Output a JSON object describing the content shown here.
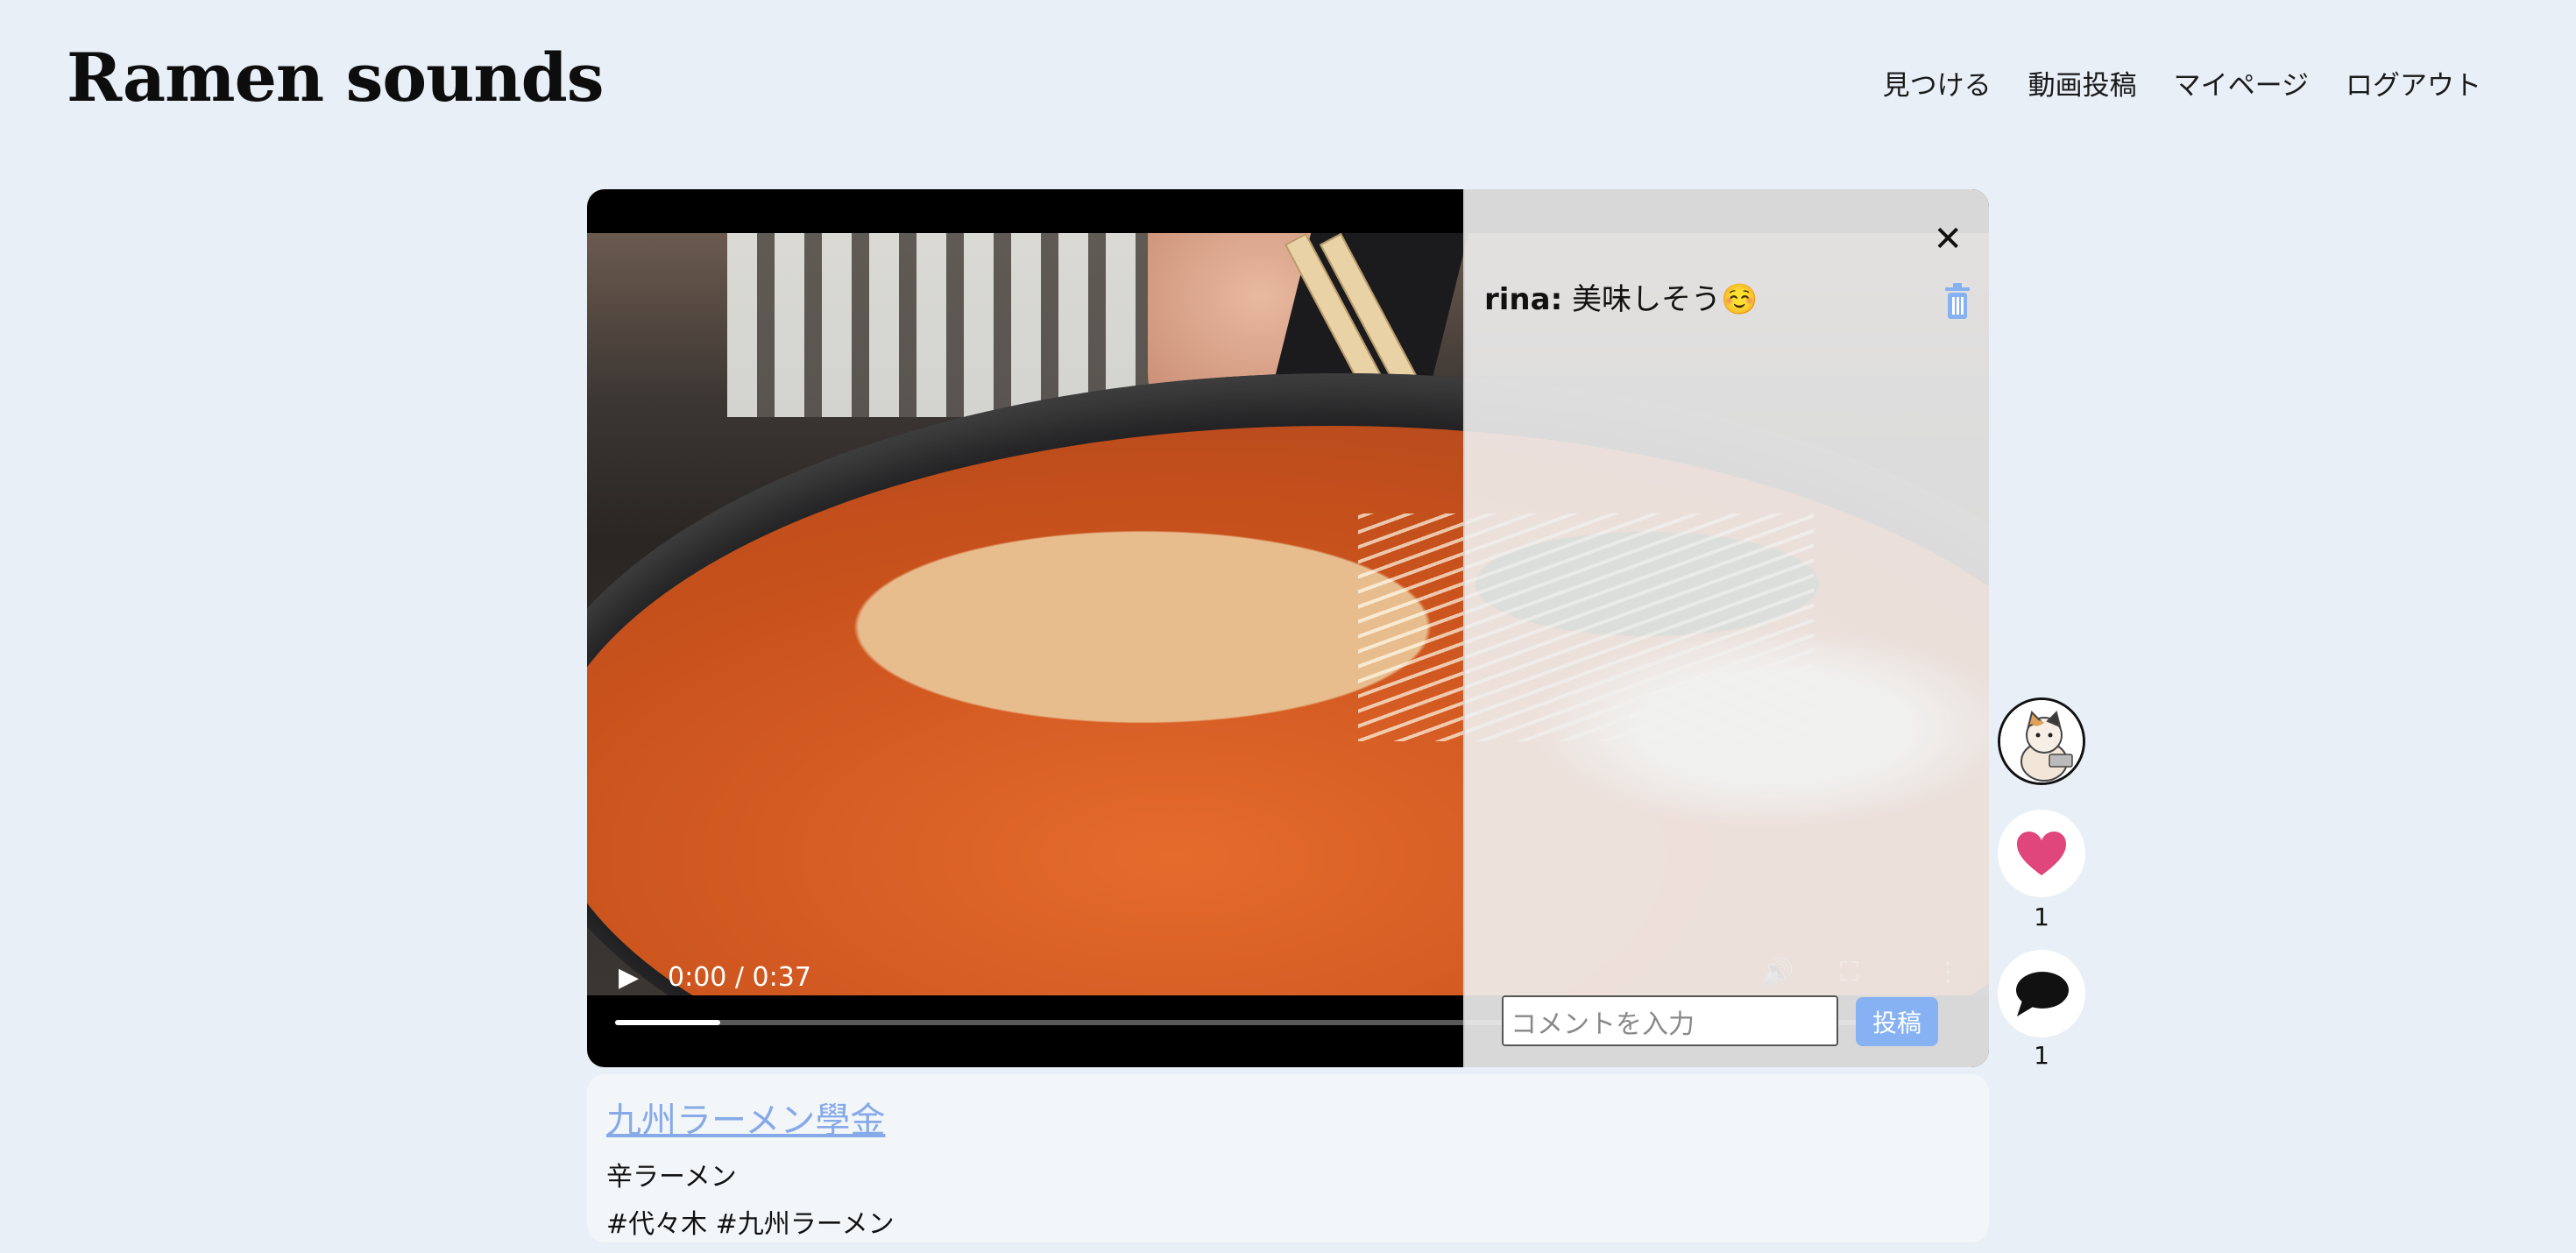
{
  "header": {
    "brand": "Ramen sounds",
    "nav": [
      {
        "label": "見つける"
      },
      {
        "label": "動画投稿"
      },
      {
        "label": "マイページ"
      },
      {
        "label": "ログアウト"
      }
    ]
  },
  "player": {
    "time": "0:00 / 0:37",
    "progress_fraction": 0.08
  },
  "comments": {
    "close_icon": "close-icon",
    "items": [
      {
        "user": "rina:",
        "text": "美味しそう☺️"
      }
    ],
    "input_placeholder": "コメントを入力",
    "post_label": "投稿"
  },
  "side": {
    "likes": "1",
    "comments": "1",
    "like_color": "#e0457b"
  },
  "post": {
    "shop_name": "九州ラーメン學金",
    "dish": "辛ラーメン",
    "tags": "#代々木 #九州ラーメン"
  }
}
